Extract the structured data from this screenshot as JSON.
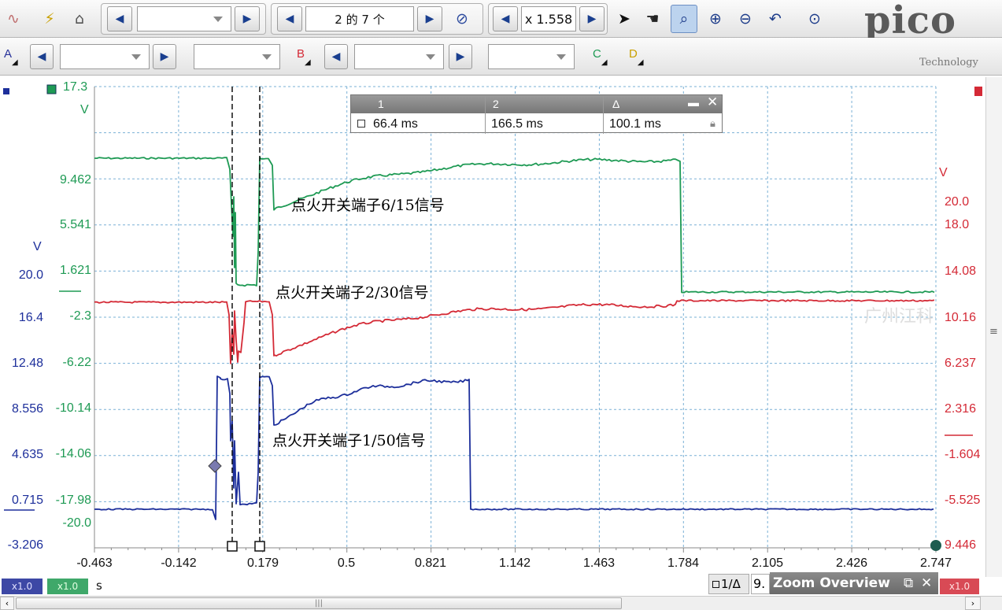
{
  "toolbar": {
    "page_counter": "2 的 7 个",
    "zoom_value": "x 1.558",
    "brand_logo": "pico",
    "brand_sub": "Technology"
  },
  "channels": {
    "a_label": "A",
    "b_label": "B",
    "c_label": "C",
    "d_label": "D"
  },
  "axes": {
    "green_unit": "V",
    "green_top": "17.3",
    "green_ticks": [
      "9.462",
      "5.541",
      "1.621",
      "-2.3",
      "-6.22",
      "-10.14",
      "-14.06",
      "-17.98",
      "-20.0"
    ],
    "blue_unit": "V",
    "blue_ticks": [
      "20.0",
      "16.4",
      "12.48",
      "8.556",
      "4.635",
      "0.715",
      "-3.206"
    ],
    "red_unit": "V",
    "red_ticks": [
      "20.0",
      "18.0",
      "14.08",
      "10.16",
      "6.237",
      "2.316",
      "-1.604",
      "-5.525",
      "9.446"
    ],
    "time_ticks": [
      "-0.463",
      "-0.142",
      "0.179",
      "0.5",
      "0.821",
      "1.142",
      "1.463",
      "1.784",
      "2.105",
      "2.426",
      "2.747"
    ],
    "time_unit": "s"
  },
  "traces": {
    "green_label": "点火开关端子6/15信号",
    "red_label": "点火开关端子2/30信号",
    "blue_label": "点火开关端子1/50信号"
  },
  "ruler": {
    "col1": "1",
    "col2": "2",
    "col3": "Δ",
    "val1": "66.4 ms",
    "val2": "166.5 ms",
    "val3": "100.1 ms"
  },
  "status": {
    "x1_a": "x1.0",
    "x1_b": "x1.0",
    "x1_c": "x1.0",
    "ratio_text": "1/Δ",
    "freq_value": "9.",
    "zoom_overview": "Zoom Overview"
  },
  "watermark": "广州江科",
  "colors": {
    "green": "#1e9a54",
    "red": "#d42a36",
    "blue": "#1d2f9b",
    "grid": "#7ab0d6",
    "toolbar": "#e8e8e8"
  }
}
